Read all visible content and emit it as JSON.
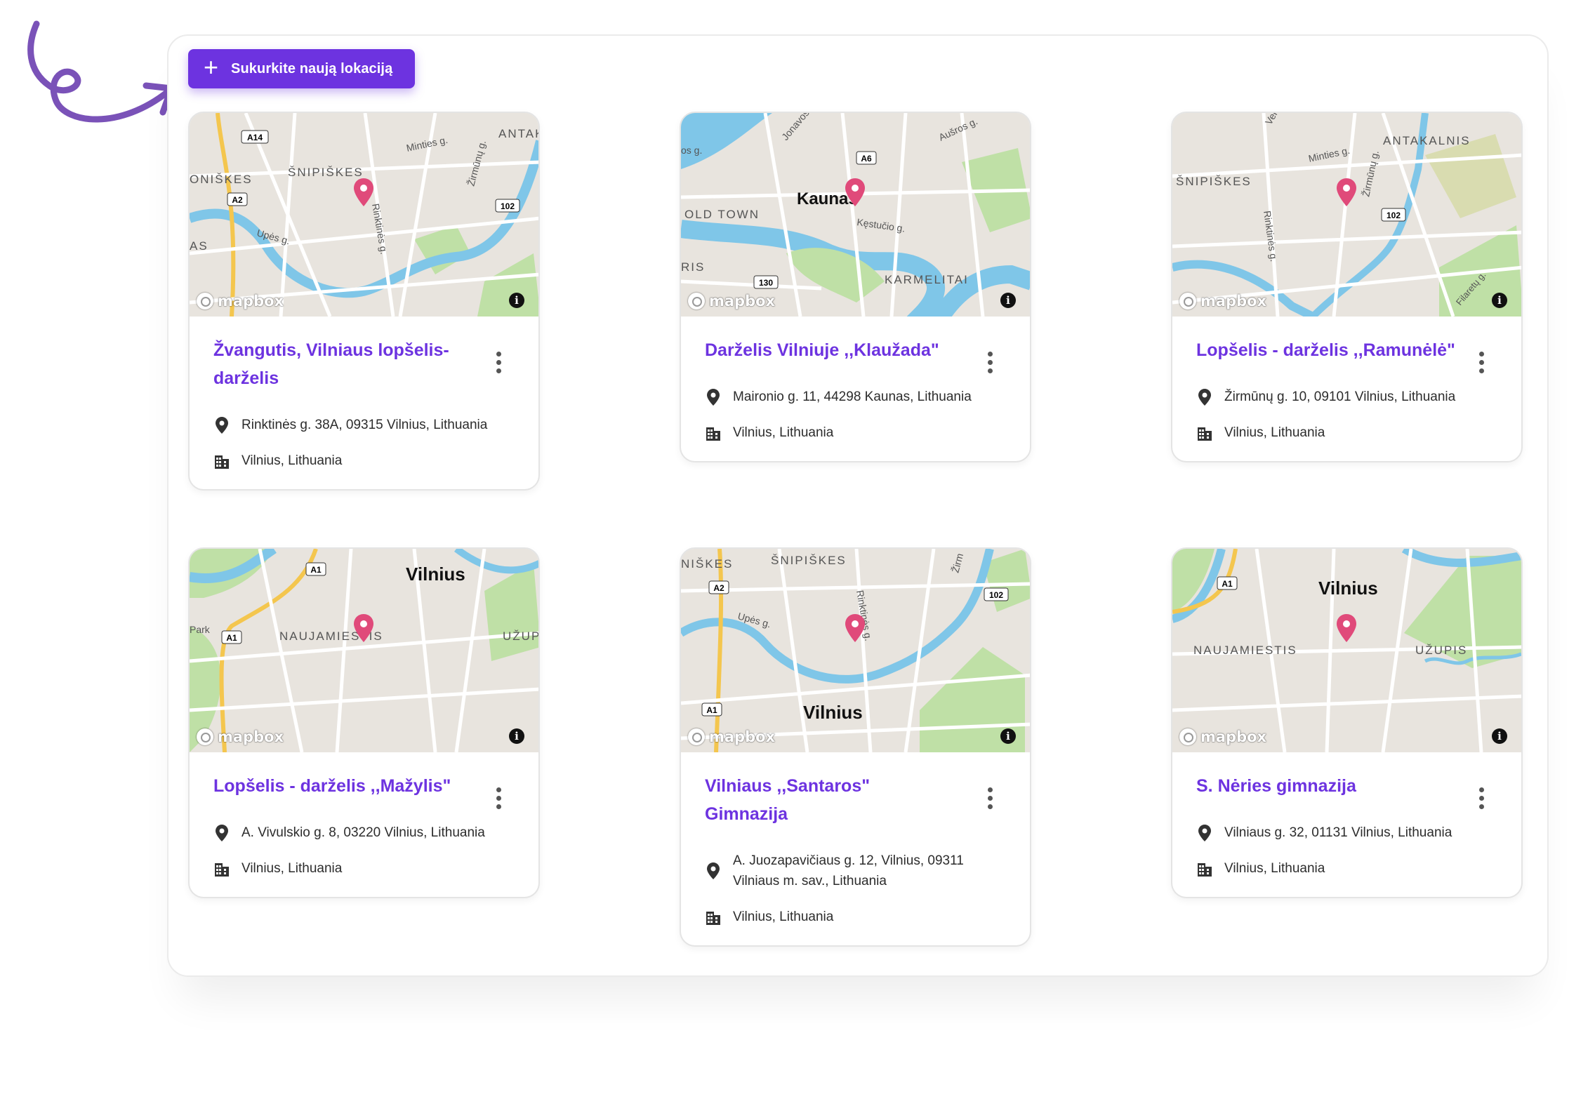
{
  "toolbar": {
    "create_label": "Sukurkite naują lokaciją"
  },
  "map_attribution": "mapbox",
  "info_glyph": "i",
  "cards": [
    {
      "title": "Žvangutis, Vilniaus lopšelis-darželis",
      "address": "Rinktinės g. 38A, 09315 Vilnius, Lithuania",
      "city": "Vilnius, Lithuania",
      "map": {
        "labels": [
          "ŠNIPIŠKES",
          "ONIŠKES",
          "Upės g.",
          "Rinktinės g.",
          "Minties g.",
          "Žirmūnų g.",
          "ANTAK",
          "AS"
        ],
        "shields": [
          "A14",
          "A2",
          "102"
        ]
      }
    },
    {
      "title": "Darželis Vilniuje ,,Klaužada\"",
      "address": "Maironio g. 11, 44298 Kaunas, Lithuania",
      "city": "Vilnius, Lithuania",
      "map": {
        "labels": [
          "Kaunas",
          "OLD TOWN",
          "KARMELITAI",
          "Kęstučio g.",
          "Jonavos",
          "Aušros g.",
          "RIS",
          "os g."
        ],
        "shields": [
          "A6",
          "130"
        ]
      }
    },
    {
      "title": "Lopšelis - darželis ,,Ramunėlė\"",
      "address": "Žirmūnų g. 10, 09101 Vilnius, Lithuania",
      "city": "Vilnius, Lithuania",
      "map": {
        "labels": [
          "ŠNIPIŠKES",
          "ANTAKALNIS",
          "Minties g.",
          "Žirmūnų g.",
          "Rinktinės g.",
          "Filaretų g.",
          "Ver"
        ],
        "shields": [
          "102"
        ]
      }
    },
    {
      "title": "Lopšelis - darželis ,,Mažylis\"",
      "address": "A. Vivulskio g. 8, 03220 Vilnius, Lithuania",
      "city": "Vilnius, Lithuania",
      "map": {
        "labels": [
          "Vilnius",
          "NAUJAMIESTIS",
          "UŽUP",
          "Park"
        ],
        "shields": [
          "A1",
          "A1"
        ]
      }
    },
    {
      "title": "Vilniaus ,,Santaros\" Gimnazija",
      "address": "A. Juozapavičiaus g. 12, Vilnius, 09311 Vilniaus m. sav., Lithuania",
      "city": "Vilnius, Lithuania",
      "map": {
        "labels": [
          "Vilnius",
          "ŠNIPIŠKES",
          "NIŠKES",
          "Upės g.",
          "Rinktinės g.",
          "Žirm"
        ],
        "shields": [
          "A2",
          "102",
          "A1"
        ]
      }
    },
    {
      "title": "S. Nėries gimnazija",
      "address": "Vilniaus g. 32, 01131 Vilnius, Lithuania",
      "city": "Vilnius, Lithuania",
      "map": {
        "labels": [
          "Vilnius",
          "NAUJAMIESTIS",
          "UŽUPIS"
        ],
        "shields": [
          "A1"
        ]
      }
    }
  ],
  "colors": {
    "accent": "#6d33e0",
    "pin": "#e04a7a",
    "water": "#7fc6e8",
    "park": "#bfe0a6",
    "road": "#ffffff",
    "land": "#e8e4de",
    "highway": "#f4c64e"
  },
  "icons": {
    "create": "plus-icon",
    "address": "map-pin-icon",
    "city": "building-icon",
    "menu": "kebab-menu-icon",
    "map_info": "info-icon"
  }
}
